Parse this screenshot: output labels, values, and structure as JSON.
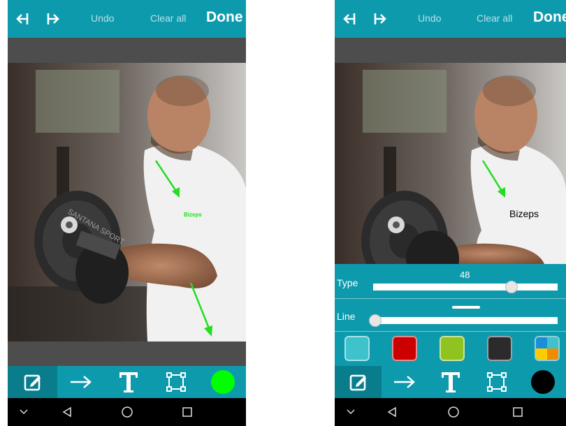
{
  "left_screen": {
    "header": {
      "undo_label": "Undo",
      "clear_all_label": "Clear all",
      "done_label": "Done"
    },
    "annotations": {
      "label_text": "Bizeps"
    },
    "toolbar": {
      "selected_color": "#00ff00",
      "active_tool": "pen"
    }
  },
  "right_screen": {
    "header": {
      "undo_label": "Undo",
      "clear_all_label": "Clear all",
      "done_label": "Done"
    },
    "annotations": {
      "label_text": "Bizeps"
    },
    "type_slider": {
      "label": "Type",
      "value": "48",
      "level": 0.77
    },
    "line_slider": {
      "label": "Line",
      "level": 0.0
    },
    "colors": [
      "#3fc2cc",
      "#cc0000",
      "#8fc31f",
      "#2b2b2b",
      "multicolor"
    ],
    "toolbar": {
      "selected_color": "#000000",
      "active_tool": "pen"
    }
  },
  "plate_text": "SANTANA SPORT",
  "theme": {
    "accent": "#0e9aad",
    "accent_dark": "#0a7d8d",
    "nav_bg": "#000000"
  }
}
